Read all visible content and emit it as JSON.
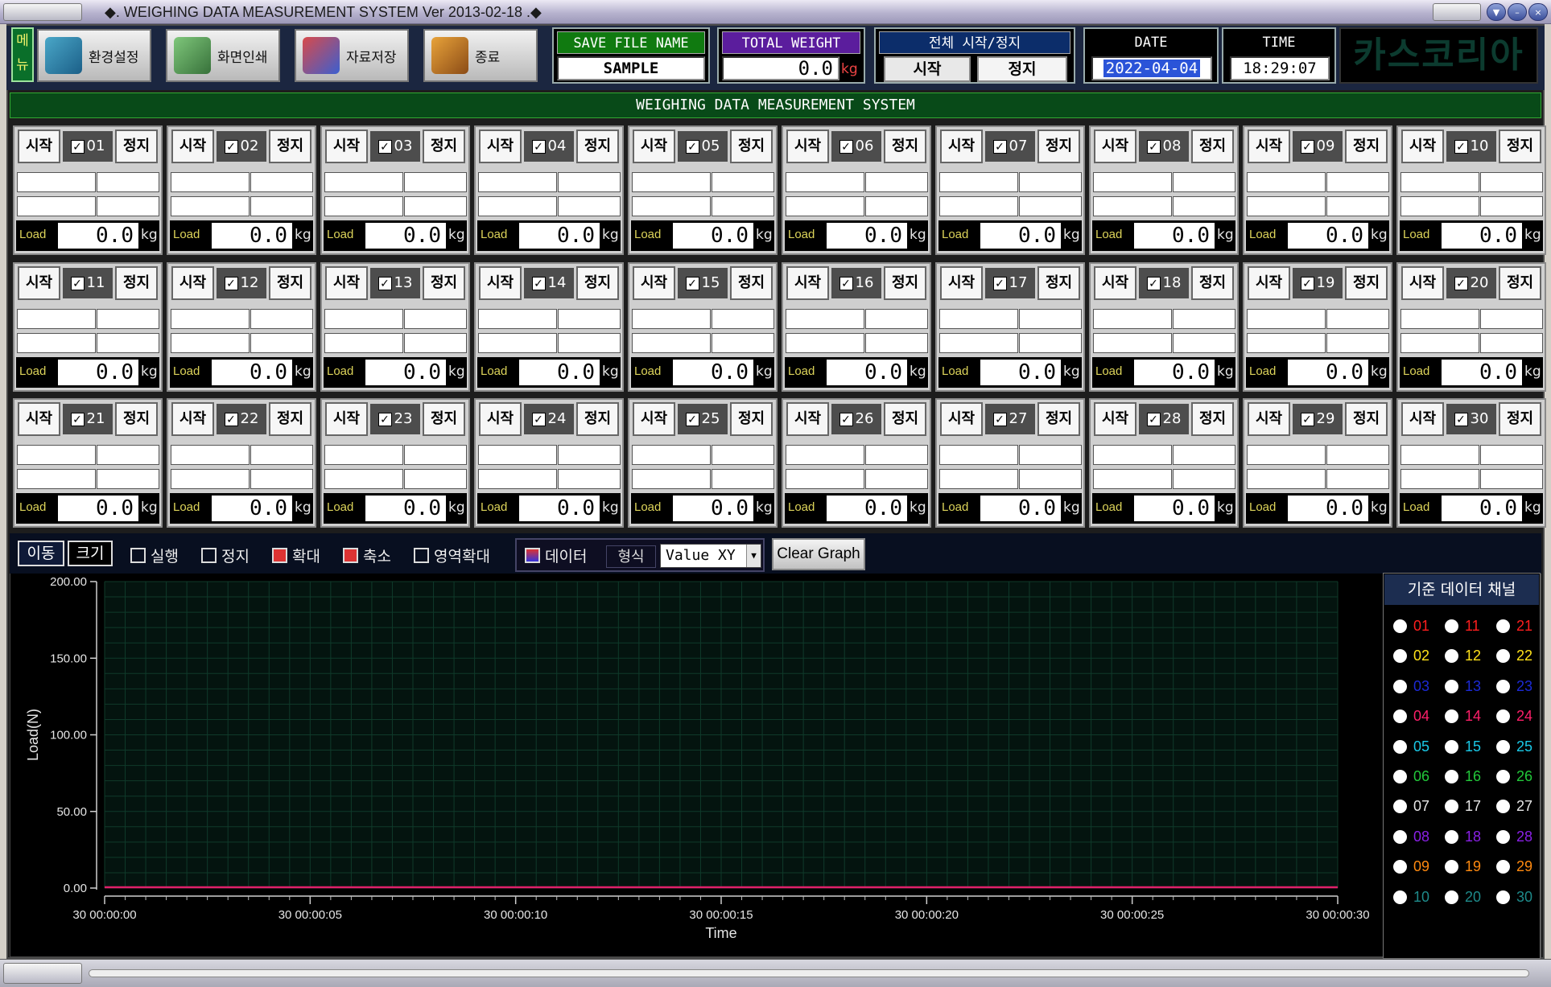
{
  "window": {
    "title": "◆. WEIGHING DATA MEASUREMENT SYSTEM  Ver 2013-02-18 .◆"
  },
  "toolbar": {
    "menu_label": "메뉴",
    "buttons": [
      {
        "label": "환경설정",
        "icon": "settings-icon"
      },
      {
        "label": "화면인쇄",
        "icon": "printer-icon"
      },
      {
        "label": "자료저장",
        "icon": "save-binder-icon"
      },
      {
        "label": "종료",
        "icon": "exit-door-icon"
      }
    ],
    "save_file": {
      "label": "SAVE FILE NAME",
      "value": "SAMPLE"
    },
    "total_weight": {
      "label": "TOTAL WEIGHT",
      "value": "0.0",
      "unit": "kg"
    },
    "all_control": {
      "label": "전체 시작/정지",
      "start": "시작",
      "stop": "정지"
    },
    "date": {
      "label": "DATE",
      "value": "2022-04-04"
    },
    "time": {
      "label": "TIME",
      "value": "18:29:07"
    },
    "logo": "카스코리아"
  },
  "main_header": "WEIGHING DATA MEASUREMENT SYSTEM",
  "channels": [
    {
      "num": "01",
      "start": "시작",
      "stop": "정지",
      "checked": true,
      "load_label": "Load",
      "value": "0.0",
      "unit": "kg"
    },
    {
      "num": "02",
      "start": "시작",
      "stop": "정지",
      "checked": true,
      "load_label": "Load",
      "value": "0.0",
      "unit": "kg"
    },
    {
      "num": "03",
      "start": "시작",
      "stop": "정지",
      "checked": true,
      "load_label": "Load",
      "value": "0.0",
      "unit": "kg"
    },
    {
      "num": "04",
      "start": "시작",
      "stop": "정지",
      "checked": true,
      "load_label": "Load",
      "value": "0.0",
      "unit": "kg"
    },
    {
      "num": "05",
      "start": "시작",
      "stop": "정지",
      "checked": true,
      "load_label": "Load",
      "value": "0.0",
      "unit": "kg"
    },
    {
      "num": "06",
      "start": "시작",
      "stop": "정지",
      "checked": true,
      "load_label": "Load",
      "value": "0.0",
      "unit": "kg"
    },
    {
      "num": "07",
      "start": "시작",
      "stop": "정지",
      "checked": true,
      "load_label": "Load",
      "value": "0.0",
      "unit": "kg"
    },
    {
      "num": "08",
      "start": "시작",
      "stop": "정지",
      "checked": true,
      "load_label": "Load",
      "value": "0.0",
      "unit": "kg"
    },
    {
      "num": "09",
      "start": "시작",
      "stop": "정지",
      "checked": true,
      "load_label": "Load",
      "value": "0.0",
      "unit": "kg"
    },
    {
      "num": "10",
      "start": "시작",
      "stop": "정지",
      "checked": true,
      "load_label": "Load",
      "value": "0.0",
      "unit": "kg"
    },
    {
      "num": "11",
      "start": "시작",
      "stop": "정지",
      "checked": true,
      "load_label": "Load",
      "value": "0.0",
      "unit": "kg"
    },
    {
      "num": "12",
      "start": "시작",
      "stop": "정지",
      "checked": true,
      "load_label": "Load",
      "value": "0.0",
      "unit": "kg"
    },
    {
      "num": "13",
      "start": "시작",
      "stop": "정지",
      "checked": true,
      "load_label": "Load",
      "value": "0.0",
      "unit": "kg"
    },
    {
      "num": "14",
      "start": "시작",
      "stop": "정지",
      "checked": true,
      "load_label": "Load",
      "value": "0.0",
      "unit": "kg"
    },
    {
      "num": "15",
      "start": "시작",
      "stop": "정지",
      "checked": true,
      "load_label": "Load",
      "value": "0.0",
      "unit": "kg"
    },
    {
      "num": "16",
      "start": "시작",
      "stop": "정지",
      "checked": true,
      "load_label": "Load",
      "value": "0.0",
      "unit": "kg"
    },
    {
      "num": "17",
      "start": "시작",
      "stop": "정지",
      "checked": true,
      "load_label": "Load",
      "value": "0.0",
      "unit": "kg"
    },
    {
      "num": "18",
      "start": "시작",
      "stop": "정지",
      "checked": true,
      "load_label": "Load",
      "value": "0.0",
      "unit": "kg"
    },
    {
      "num": "19",
      "start": "시작",
      "stop": "정지",
      "checked": true,
      "load_label": "Load",
      "value": "0.0",
      "unit": "kg"
    },
    {
      "num": "20",
      "start": "시작",
      "stop": "정지",
      "checked": true,
      "load_label": "Load",
      "value": "0.0",
      "unit": "kg"
    },
    {
      "num": "21",
      "start": "시작",
      "stop": "정지",
      "checked": true,
      "load_label": "Load",
      "value": "0.0",
      "unit": "kg"
    },
    {
      "num": "22",
      "start": "시작",
      "stop": "정지",
      "checked": true,
      "load_label": "Load",
      "value": "0.0",
      "unit": "kg"
    },
    {
      "num": "23",
      "start": "시작",
      "stop": "정지",
      "checked": true,
      "load_label": "Load",
      "value": "0.0",
      "unit": "kg"
    },
    {
      "num": "24",
      "start": "시작",
      "stop": "정지",
      "checked": true,
      "load_label": "Load",
      "value": "0.0",
      "unit": "kg"
    },
    {
      "num": "25",
      "start": "시작",
      "stop": "정지",
      "checked": true,
      "load_label": "Load",
      "value": "0.0",
      "unit": "kg"
    },
    {
      "num": "26",
      "start": "시작",
      "stop": "정지",
      "checked": true,
      "load_label": "Load",
      "value": "0.0",
      "unit": "kg"
    },
    {
      "num": "27",
      "start": "시작",
      "stop": "정지",
      "checked": true,
      "load_label": "Load",
      "value": "0.0",
      "unit": "kg"
    },
    {
      "num": "28",
      "start": "시작",
      "stop": "정지",
      "checked": true,
      "load_label": "Load",
      "value": "0.0",
      "unit": "kg"
    },
    {
      "num": "29",
      "start": "시작",
      "stop": "정지",
      "checked": true,
      "load_label": "Load",
      "value": "0.0",
      "unit": "kg"
    },
    {
      "num": "30",
      "start": "시작",
      "stop": "정지",
      "checked": true,
      "load_label": "Load",
      "value": "0.0",
      "unit": "kg"
    }
  ],
  "graph_toolbar": {
    "move": "이동",
    "size": "크기",
    "run": "실행",
    "stop": "정지",
    "zoom_in": "확대",
    "zoom_out": "축소",
    "area_zoom": "영역확대",
    "data": "데이터",
    "type_label": "형식",
    "type_value": "Value XY",
    "clear": "Clear Graph"
  },
  "chart_data": {
    "type": "line",
    "xlabel": "Time",
    "ylabel": "Load(N)",
    "ylim": [
      0,
      200
    ],
    "yticks": [
      "200.00",
      "150.00",
      "100.00",
      "50.00",
      "0.00"
    ],
    "xticks": [
      "30 00:00:00",
      "30 00:00:05",
      "30 00:00:10",
      "30 00:00:15",
      "30 00:00:20",
      "30 00:00:25",
      "30 00:00:30"
    ],
    "x_range_seconds": [
      0,
      30
    ],
    "grid": true,
    "background": "#04140f",
    "grid_color": "#0f3a2a",
    "series": [
      {
        "color": "#e0206a",
        "x": [
          0,
          30
        ],
        "y": [
          0,
          0
        ]
      }
    ]
  },
  "reference_panel": {
    "title": "기준 데이터 채널",
    "channels": [
      {
        "num": "01",
        "color": "#ff1e1e"
      },
      {
        "num": "11",
        "color": "#ff1e1e"
      },
      {
        "num": "21",
        "color": "#ff1e1e"
      },
      {
        "num": "02",
        "color": "#ffe21a"
      },
      {
        "num": "12",
        "color": "#ffe21a"
      },
      {
        "num": "22",
        "color": "#ffe21a"
      },
      {
        "num": "03",
        "color": "#1c2ad6"
      },
      {
        "num": "13",
        "color": "#1c2ad6"
      },
      {
        "num": "23",
        "color": "#1c2ad6"
      },
      {
        "num": "04",
        "color": "#ff1f6a"
      },
      {
        "num": "14",
        "color": "#ff1f6a"
      },
      {
        "num": "24",
        "color": "#ff1f6a"
      },
      {
        "num": "05",
        "color": "#1ac8e6"
      },
      {
        "num": "15",
        "color": "#1ac8e6"
      },
      {
        "num": "25",
        "color": "#1ac8e6"
      },
      {
        "num": "06",
        "color": "#22c83a"
      },
      {
        "num": "16",
        "color": "#22c83a"
      },
      {
        "num": "26",
        "color": "#22c83a"
      },
      {
        "num": "07",
        "color": "#e8e8e8"
      },
      {
        "num": "17",
        "color": "#e8e8e8"
      },
      {
        "num": "27",
        "color": "#e8e8e8"
      },
      {
        "num": "08",
        "color": "#8a20e6"
      },
      {
        "num": "18",
        "color": "#8a20e6"
      },
      {
        "num": "28",
        "color": "#8a20e6"
      },
      {
        "num": "09",
        "color": "#ff8a10"
      },
      {
        "num": "19",
        "color": "#ff8a10"
      },
      {
        "num": "29",
        "color": "#ff8a10"
      },
      {
        "num": "10",
        "color": "#1e8a8a"
      },
      {
        "num": "20",
        "color": "#1e8a8a"
      },
      {
        "num": "30",
        "color": "#1e8a8a"
      }
    ]
  }
}
